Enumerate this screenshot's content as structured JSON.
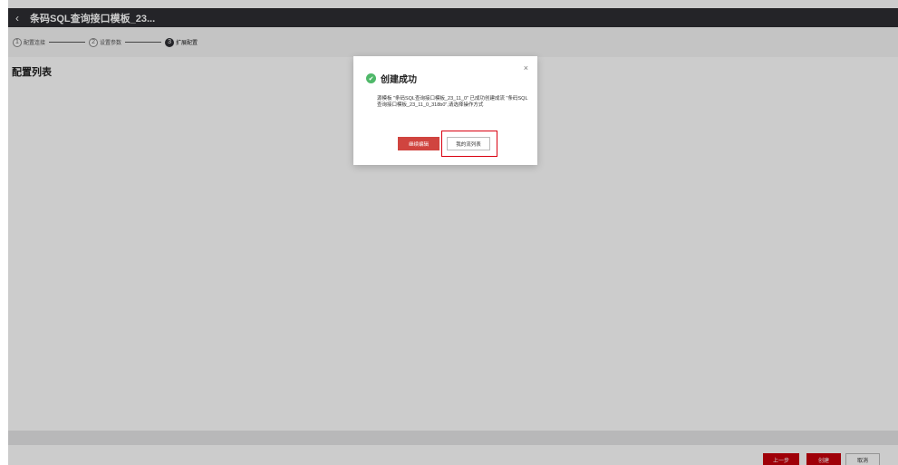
{
  "header": {
    "back_icon": "chevron-left-icon",
    "title": "条码SQL查询接口模板_23..."
  },
  "stepper": {
    "steps": [
      {
        "num": "1",
        "label": "配置连接"
      },
      {
        "num": "2",
        "label": "设置参数"
      },
      {
        "num": "3",
        "label": "扩展配置"
      }
    ]
  },
  "main": {
    "title": "配置列表"
  },
  "footer": {
    "prev_label": "上一步",
    "create_label": "创建",
    "cancel_label": "取消"
  },
  "modal": {
    "title": "创建成功",
    "message": "源模板 \"条码SQL查询接口模板_23_11_0\" 已成功创建成流 \"条码SQL查询接口模板_23_11_0_318b0\",请选择操作方式",
    "continue_label": "继续编辑",
    "my_flows_label": "我的流列表",
    "close_glyph": "×",
    "success_color": "#4fb869"
  }
}
